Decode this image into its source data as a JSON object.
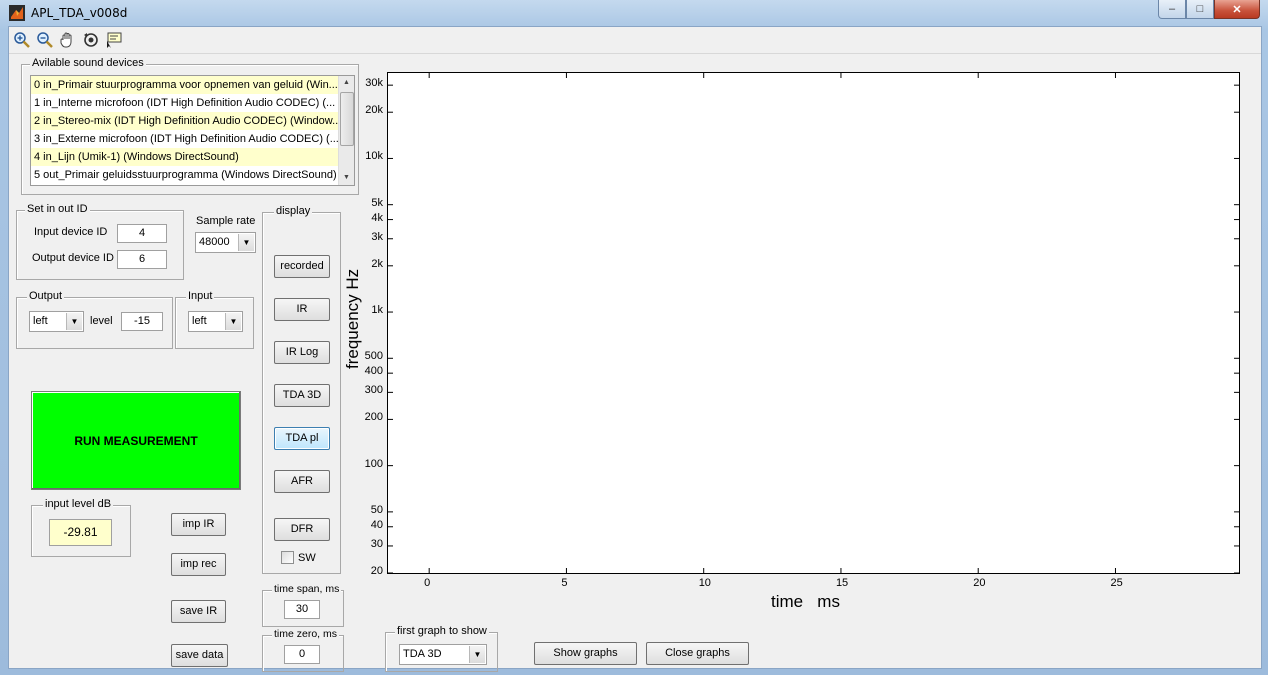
{
  "window": {
    "title": "APL_TDA_v008d",
    "min_label": "–",
    "max_label": "□",
    "close_label": "✕"
  },
  "toolbar": {
    "icons": [
      "zoom-in-icon",
      "zoom-out-icon",
      "pan-hand-icon",
      "rotate-3d-icon",
      "data-cursor-icon"
    ]
  },
  "devices": {
    "legend": "Avilable sound devices",
    "items": [
      {
        "label": "0 in_Primair stuurprogramma voor opnemen van geluid (Win..."
      },
      {
        "label": "1 in_Interne microfoon (IDT High Definition Audio CODEC) (..."
      },
      {
        "label": "2 in_Stereo-mix (IDT High Definition Audio CODEC) (Window..."
      },
      {
        "label": "3 in_Externe microfoon (IDT High Definition Audio CODEC) (..."
      },
      {
        "label": "4 in_Lijn (Umik-1) (Windows DirectSound)"
      },
      {
        "label": "5 out_Primair geluidsstuurprogramma (Windows DirectSound)"
      }
    ]
  },
  "setid": {
    "legend": "Set in out ID",
    "input_label": "Input device ID",
    "input_value": "4",
    "output_label": "Output device ID",
    "output_value": "6"
  },
  "samplerate": {
    "label": "Sample rate",
    "value": "48000"
  },
  "output": {
    "legend": "Output",
    "channel": "left",
    "level_label": "level",
    "level_value": "-15"
  },
  "input": {
    "legend": "Input",
    "channel": "left"
  },
  "run_label": "RUN MEASUREMENT",
  "input_level": {
    "legend": "input level dB",
    "value": "-29.81"
  },
  "actions": {
    "imp_ir": "imp IR",
    "imp_rec": "imp rec",
    "save_ir": "save IR",
    "save_data": "save data"
  },
  "display": {
    "legend": "display",
    "buttons": [
      "recorded",
      "IR",
      "IR Log",
      "TDA 3D",
      "TDA pl",
      "AFR",
      "DFR"
    ],
    "sw_label": "SW"
  },
  "timespan": {
    "legend": "time span, ms",
    "value": "30"
  },
  "timezero": {
    "legend": "time zero, ms",
    "value": "0"
  },
  "firstgraph": {
    "legend": "first graph to show",
    "value": "TDA 3D"
  },
  "show_graphs": "Show graphs",
  "close_graphs": "Close graphs",
  "plot": {
    "ylabel": "frequency   Hz",
    "xlabel": "time   ms",
    "ytick_labels": [
      "20",
      "30",
      "40",
      "50",
      "100",
      "200",
      "300",
      "400",
      "500",
      "1k",
      "2k",
      "3k",
      "4k",
      "5k",
      "10k",
      "20k",
      "30k"
    ],
    "xtick_labels": [
      "0",
      "5",
      "10",
      "15",
      "20",
      "25"
    ]
  },
  "chart_data": {
    "type": "heatmap",
    "x": {
      "label": "time   ms",
      "range": [
        -1.5,
        29.5
      ],
      "ticks": [
        0,
        5,
        10,
        15,
        20,
        25
      ],
      "data_range": [
        -1,
        29
      ]
    },
    "y": {
      "label": "frequency   Hz",
      "scale": "log",
      "range": [
        20,
        36000
      ],
      "ticks": [
        20,
        30,
        40,
        50,
        100,
        200,
        300,
        400,
        500,
        1000,
        2000,
        3000,
        4000,
        5000,
        10000,
        20000,
        30000
      ],
      "data_range": [
        35,
        33000
      ]
    },
    "colormap": "jet",
    "colors": {
      "low": "#00008f",
      "high": "#800000"
    }
  }
}
